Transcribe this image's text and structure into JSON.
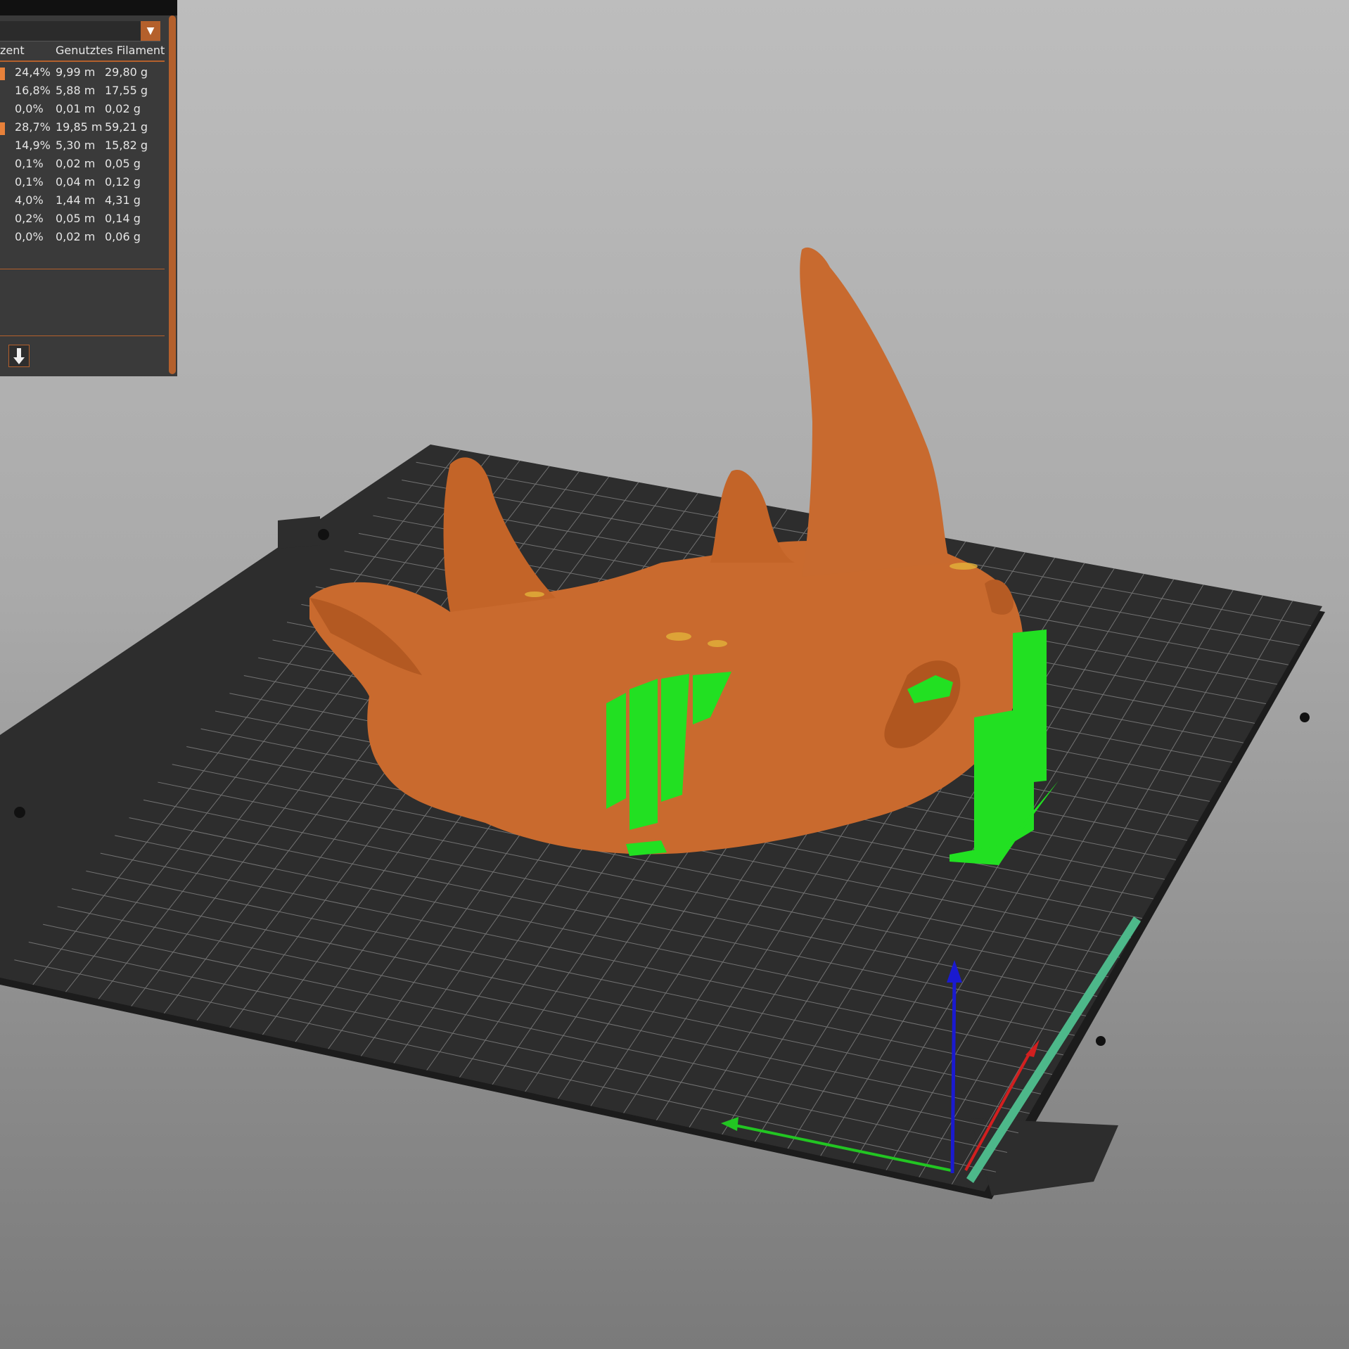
{
  "colors": {
    "model": "#c96a2e",
    "support": "#22e022",
    "bed": "#2d2d2d",
    "accent": "#b4602c",
    "axis_x": "#d21f1f",
    "axis_y": "#22c522",
    "axis_z": "#1a1ad0"
  },
  "legend": {
    "dropdown_arrow": "▼",
    "col_percent": "zent",
    "col_filament": "Genutztes Filament",
    "rows": [
      {
        "percent": "24,4%",
        "length": "9,99 m",
        "weight": "29,80 g",
        "highlighted": true
      },
      {
        "percent": "16,8%",
        "length": "5,88 m",
        "weight": "17,55 g",
        "highlighted": false
      },
      {
        "percent": "0,0%",
        "length": "0,01 m",
        "weight": "0,02 g",
        "highlighted": false
      },
      {
        "percent": "28,7%",
        "length": "19,85 m",
        "weight": "59,21 g",
        "highlighted": true
      },
      {
        "percent": "14,9%",
        "length": "5,30 m",
        "weight": "15,82 g",
        "highlighted": false
      },
      {
        "percent": "0,1%",
        "length": "0,02 m",
        "weight": "0,05 g",
        "highlighted": false
      },
      {
        "percent": "0,1%",
        "length": "0,04 m",
        "weight": "0,12 g",
        "highlighted": false
      },
      {
        "percent": "4,0%",
        "length": "1,44 m",
        "weight": "4,31 g",
        "highlighted": false
      },
      {
        "percent": "0,2%",
        "length": "0,05 m",
        "weight": "0,14 g",
        "highlighted": false
      },
      {
        "percent": "0,0%",
        "length": "0,02 m",
        "weight": "0,06 g",
        "highlighted": false
      }
    ],
    "export_icon": "download-arrow-icon"
  }
}
